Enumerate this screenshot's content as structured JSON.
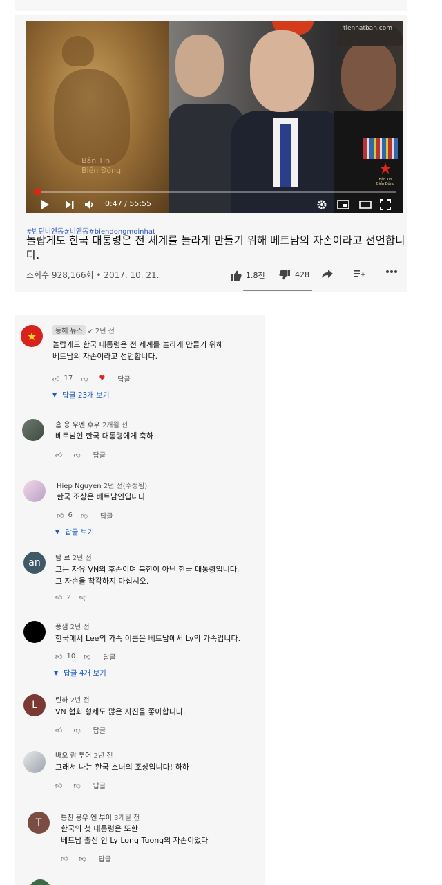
{
  "video": {
    "watermark": "tienhatban.com",
    "left_watermark_line1": "Bản Tin",
    "left_watermark_line2": "Biển Đông",
    "channel_logo_text": "Bản Tin Biển Đông",
    "time": "0:47 / 55:55",
    "progress": 0.014
  },
  "hashtags": "#반틴비엔동#비엔동#biendongmoinhat",
  "title": "놀랍게도 한국 대통령은 전 세계를 놀라게 만들기 위해 베트남의 자손이라고 선언합니다.",
  "meta": {
    "views": "조회수 928,166회 • 2017. 10. 21.",
    "likes": "1.8천",
    "dislikes": "428"
  },
  "comments": [
    {
      "author": "동해 뉴스",
      "ago": "2년 전",
      "text": "놀랍게도 한국 대통령은 전 세계를 놀라게 만들기 위해\n베트남의 자손이라고 선언합니다.",
      "likes": "17",
      "reply": "답글",
      "more": "답글 23개 보기"
    },
    {
      "author": "흠 응 우엔 후우",
      "ago": "2개월 전",
      "text": "베트남인 한국 대통령에게 축하",
      "likes": "",
      "reply": "답글"
    },
    {
      "author": "Hiep Nguyen",
      "ago": "2년 전(수정됨)",
      "text": "한국 조상은 베트남인입니다",
      "likes": "6",
      "reply": "답글",
      "more": "답글 보기"
    },
    {
      "author": "탐 르",
      "ago": "2년 전",
      "avatar_text": "an",
      "text": "그는 자유 VN의 후손이며 북한이 아닌 한국 대통령입니다.\n그 자손을 착각하지 마십시오.",
      "likes": "2"
    },
    {
      "author": "퐁샘",
      "ago": "2년 전",
      "text": "한국에서 Lee의 가족 이름은 베트남에서 Ly의 가족입니다.",
      "likes": "10",
      "reply": "답글",
      "more": "답글 4개 보기"
    },
    {
      "author": "린하",
      "ago": "2년 전",
      "avatar_text": "L",
      "text": "VN 협회 형제도 많은 사진을 좋아합니다.",
      "likes": "",
      "reply": "답글"
    },
    {
      "author": "바오 람 투어",
      "ago": "2년 전",
      "text": "그래서 나는 한국 소녀의 조상입니다! 하하",
      "likes": "",
      "reply": "답글"
    },
    {
      "author": "퉁친 응우 엔 부이",
      "ago": "3개월 전",
      "avatar_text": "T",
      "text": "한국의 첫 대통령은 또한\n베트남 출신 인 Ly Long Tuong의 자손이었다",
      "likes": "",
      "reply": "답글"
    }
  ],
  "colors": {
    "red": "#e62117",
    "link": "#1a5bc4"
  }
}
